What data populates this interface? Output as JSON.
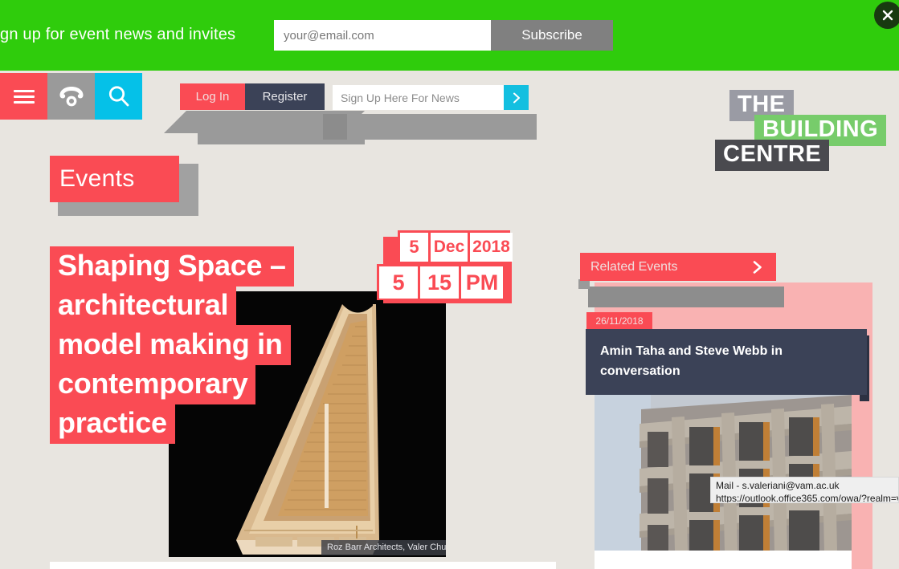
{
  "banner": {
    "text": "gn up for event news and invites",
    "email_placeholder": "your@email.com",
    "email_value": "",
    "subscribe_label": "Subscribe",
    "close_icon": "close-icon",
    "bg_color": "#2fcc0c"
  },
  "nav": {
    "menu_icon": "hamburger-menu-icon",
    "phone_icon": "phone-icon",
    "search_icon": "search-icon",
    "login_label": "Log In",
    "register_label": "Register",
    "newsletter_placeholder": "Sign Up Here For News",
    "newsletter_value": "",
    "newsletter_submit_icon": "chevron-right-icon"
  },
  "logo": {
    "line1": "THE",
    "line2": "BUILDING",
    "line3": "CENTRE",
    "color1": "#9a9ba4",
    "color2": "#77cc6b",
    "color3": "#4a4a4f"
  },
  "section": {
    "heading": "Events"
  },
  "hero": {
    "title_lines": [
      "Shaping Space –",
      "architectural",
      "model making in",
      "contemporary",
      "practice"
    ],
    "caption": "Roz Barr Architects, Valer Church model © Andrew Pulter",
    "date": {
      "day": "5",
      "month": "Dec",
      "year": "2018",
      "hour": "5",
      "minute": "15",
      "ampm": "PM"
    },
    "accent_color": "#fa4b54"
  },
  "related": {
    "header_label": "Related Events",
    "header_icon": "chevron-right-icon",
    "items": [
      {
        "date": "26/11/2018",
        "title": "Amin Taha and Steve Webb in conversation"
      }
    ]
  },
  "tooltip": {
    "line1": "Mail - s.valeriani@vam.ac.uk",
    "line2": "https://outlook.office365.com/owa/?realm=v"
  }
}
